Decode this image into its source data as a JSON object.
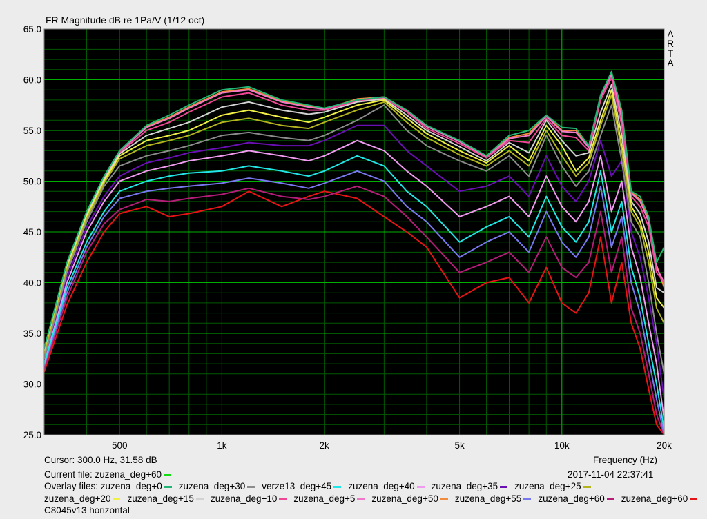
{
  "title": "FR Magnitude dB re 1Pa/V (1/12 oct)",
  "brand": [
    "A",
    "R",
    "T",
    "A"
  ],
  "cursor_readout": "Cursor: 300.0 Hz, 31.58 dB",
  "x_axis_label": "Frequency (Hz)",
  "current_file": {
    "label": "Current file: zuzena_deg+60",
    "color": "#11dd11"
  },
  "timestamp": "2017-11-04  22:37:41",
  "overlay_prefix": "Overlay files:",
  "caption": "C8045v13 horizontal",
  "colors": {
    "background": "#000000",
    "grid_major": "#00b000",
    "grid_minor": "#005a00",
    "frame": "#ececec"
  },
  "chart_data": {
    "type": "line",
    "title": "FR Magnitude dB re 1Pa/V (1/12 oct)",
    "xlabel": "Frequency (Hz)",
    "ylabel": "",
    "x_scale": "log",
    "xlim": [
      300,
      20000
    ],
    "ylim": [
      25,
      65
    ],
    "x_ticks": [
      {
        "value": 500,
        "label": "500"
      },
      {
        "value": 1000,
        "label": "1k"
      },
      {
        "value": 2000,
        "label": "2k"
      },
      {
        "value": 5000,
        "label": "5k"
      },
      {
        "value": 10000,
        "label": "10k"
      },
      {
        "value": 20000,
        "label": "20k"
      }
    ],
    "y_ticks": [
      {
        "value": 25,
        "label": "25.0"
      },
      {
        "value": 30,
        "label": "30.0"
      },
      {
        "value": 35,
        "label": "35.0"
      },
      {
        "value": 40,
        "label": "40.0"
      },
      {
        "value": 45,
        "label": "45.0"
      },
      {
        "value": 50,
        "label": "50.0"
      },
      {
        "value": 55,
        "label": "55.0"
      },
      {
        "value": 60,
        "label": "60.0"
      },
      {
        "value": 65,
        "label": "65.0"
      }
    ],
    "grid": true,
    "x": [
      300,
      350,
      400,
      450,
      500,
      600,
      700,
      800,
      1000,
      1200,
      1500,
      1800,
      2000,
      2500,
      3000,
      3500,
      4000,
      5000,
      6000,
      7000,
      8000,
      9000,
      10000,
      11000,
      12000,
      13000,
      14000,
      15000,
      16000,
      17000,
      18000,
      19000,
      20000
    ],
    "series": [
      {
        "name": "zuzena_deg+0",
        "color": "#22b573",
        "values": [
          33.5,
          42.0,
          47.0,
          50.5,
          53.0,
          55.5,
          56.5,
          57.5,
          59.0,
          59.3,
          58.0,
          57.5,
          57.2,
          58.0,
          58.3,
          57.0,
          55.5,
          54.0,
          52.5,
          54.5,
          55.0,
          56.5,
          55.3,
          55.2,
          53.5,
          58.5,
          60.8,
          57.0,
          49.0,
          48.5,
          46.5,
          42.0,
          43.5
        ]
      },
      {
        "name": "zuzena_deg+30",
        "color": "#8c8c8c",
        "values": [
          32.5,
          41.0,
          46.0,
          49.5,
          51.5,
          52.5,
          53.0,
          53.5,
          54.5,
          54.8,
          54.3,
          54.0,
          54.5,
          56.0,
          57.5,
          55.0,
          53.5,
          52.0,
          51.0,
          52.5,
          50.5,
          54.5,
          51.5,
          49.5,
          51.0,
          54.5,
          57.5,
          52.0,
          46.0,
          44.5,
          40.0,
          35.0,
          31.0
        ]
      },
      {
        "name": "verze13_deg+45",
        "color": "#22e6e6",
        "values": [
          32.0,
          39.5,
          44.0,
          47.0,
          49.0,
          50.0,
          50.5,
          50.8,
          51.0,
          51.5,
          51.0,
          50.5,
          51.0,
          52.5,
          51.5,
          49.0,
          47.5,
          44.0,
          45.5,
          46.5,
          44.5,
          48.5,
          45.5,
          44.0,
          46.0,
          51.0,
          45.0,
          48.0,
          41.5,
          38.5,
          34.0,
          30.0,
          25.5
        ]
      },
      {
        "name": "zuzena_deg+40",
        "color": "#f09bf0",
        "values": [
          32.0,
          40.0,
          45.0,
          48.0,
          50.0,
          51.0,
          51.5,
          52.0,
          52.5,
          53.0,
          52.5,
          52.0,
          52.5,
          54.0,
          53.0,
          51.0,
          49.5,
          46.5,
          47.5,
          48.5,
          46.5,
          50.5,
          47.5,
          46.0,
          48.0,
          52.5,
          47.0,
          50.0,
          43.5,
          40.5,
          36.0,
          32.0,
          26.5
        ]
      },
      {
        "name": "zuzena_deg+35",
        "color": "#6a0fb4",
        "values": [
          32.5,
          40.5,
          45.5,
          48.5,
          50.5,
          51.8,
          52.3,
          52.8,
          53.3,
          53.8,
          53.5,
          53.5,
          54.0,
          55.5,
          55.5,
          53.0,
          51.5,
          49.0,
          49.5,
          50.5,
          48.5,
          52.5,
          49.5,
          48.0,
          50.0,
          54.0,
          50.5,
          52.0,
          45.0,
          42.5,
          38.5,
          34.0,
          28.5
        ]
      },
      {
        "name": "zuzena_deg+25",
        "color": "#b4b41e",
        "values": [
          32.8,
          41.3,
          46.3,
          49.8,
          52.2,
          53.5,
          54.0,
          54.5,
          55.8,
          56.2,
          55.5,
          55.2,
          55.8,
          57.0,
          57.8,
          55.8,
          54.3,
          52.6,
          51.5,
          53.0,
          51.5,
          55.0,
          52.5,
          50.5,
          51.8,
          55.5,
          58.5,
          53.0,
          47.0,
          45.5,
          42.0,
          37.5,
          36.0
        ]
      },
      {
        "name": "zuzena_deg+20",
        "color": "#f0f046",
        "values": [
          33.0,
          41.5,
          46.5,
          50.0,
          52.5,
          54.0,
          54.5,
          55.0,
          56.5,
          57.0,
          56.3,
          55.8,
          56.3,
          57.5,
          58.0,
          56.2,
          54.7,
          53.0,
          51.8,
          53.5,
          52.0,
          55.5,
          53.5,
          51.0,
          52.3,
          56.0,
          59.0,
          53.5,
          47.5,
          46.0,
          43.0,
          38.5,
          37.5
        ]
      },
      {
        "name": "zuzena_deg+15",
        "color": "#d2d2d2",
        "values": [
          33.2,
          41.7,
          46.7,
          50.2,
          52.7,
          54.5,
          55.2,
          55.8,
          57.3,
          57.8,
          57.0,
          56.6,
          56.8,
          57.8,
          58.1,
          56.5,
          55.0,
          53.4,
          52.0,
          53.8,
          52.8,
          56.0,
          54.0,
          52.5,
          52.8,
          56.8,
          59.5,
          54.5,
          48.0,
          46.8,
          44.0,
          39.5,
          39.0
        ]
      },
      {
        "name": "zuzena_deg+10",
        "color": "#f04696",
        "values": [
          33.3,
          41.8,
          46.8,
          50.3,
          52.8,
          55.0,
          55.8,
          56.8,
          58.3,
          58.7,
          57.5,
          57.0,
          57.0,
          57.9,
          58.2,
          56.8,
          55.2,
          53.7,
          52.3,
          54.0,
          53.8,
          56.2,
          54.5,
          54.3,
          53.0,
          58.0,
          60.2,
          55.5,
          48.5,
          47.5,
          45.5,
          41.0,
          40.0
        ]
      },
      {
        "name": "zuzena_deg+5",
        "color": "#f078c8",
        "values": [
          33.4,
          41.9,
          46.9,
          50.4,
          52.9,
          55.3,
          56.2,
          57.2,
          58.7,
          59.0,
          57.8,
          57.3,
          57.1,
          58.0,
          58.3,
          56.9,
          55.4,
          53.9,
          52.4,
          54.2,
          54.5,
          56.4,
          54.9,
          54.8,
          53.3,
          58.3,
          60.5,
          56.2,
          48.8,
          48.0,
          46.0,
          41.5,
          40.0
        ]
      },
      {
        "name": "zuzena_deg+50",
        "color": "#f08c3c",
        "values": [
          33.4,
          41.9,
          46.9,
          50.4,
          52.9,
          55.4,
          56.3,
          57.3,
          58.8,
          59.1,
          57.9,
          57.4,
          57.1,
          58.1,
          58.3,
          57.0,
          55.4,
          54.0,
          52.5,
          54.3,
          54.7,
          56.5,
          55.0,
          55.0,
          53.4,
          58.4,
          60.6,
          56.5,
          48.9,
          48.2,
          46.2,
          41.7,
          39.5
        ]
      },
      {
        "name": "zuzena_deg+55",
        "color": "#7878f0",
        "values": [
          31.8,
          39.0,
          43.5,
          46.5,
          48.3,
          49.0,
          49.3,
          49.5,
          49.8,
          50.3,
          49.8,
          49.3,
          49.8,
          51.0,
          50.0,
          47.5,
          46.0,
          42.5,
          44.0,
          45.0,
          43.0,
          47.0,
          44.0,
          42.5,
          44.5,
          49.5,
          43.5,
          46.5,
          40.0,
          37.0,
          32.5,
          28.5,
          25.0
        ]
      },
      {
        "name": "zuzena_deg+60",
        "color": "#b41e78",
        "values": [
          31.5,
          38.5,
          43.0,
          45.8,
          47.2,
          48.2,
          48.0,
          48.3,
          48.7,
          49.3,
          48.5,
          48.2,
          48.5,
          49.5,
          48.5,
          46.5,
          44.5,
          41.0,
          42.0,
          43.0,
          41.0,
          44.5,
          41.5,
          40.5,
          42.0,
          47.0,
          41.0,
          44.5,
          37.5,
          35.0,
          31.0,
          27.0,
          25.0
        ]
      },
      {
        "name": "zuzena_deg+60",
        "color": "#e61414",
        "values": [
          31.2,
          37.8,
          42.0,
          45.0,
          46.8,
          47.5,
          46.5,
          46.8,
          47.5,
          49.0,
          47.5,
          48.5,
          49.0,
          48.3,
          46.5,
          45.0,
          43.5,
          38.5,
          40.0,
          40.5,
          38.0,
          41.5,
          38.0,
          37.0,
          39.0,
          44.5,
          38.0,
          42.0,
          36.0,
          33.5,
          29.5,
          26.0,
          25.0
        ]
      }
    ]
  }
}
